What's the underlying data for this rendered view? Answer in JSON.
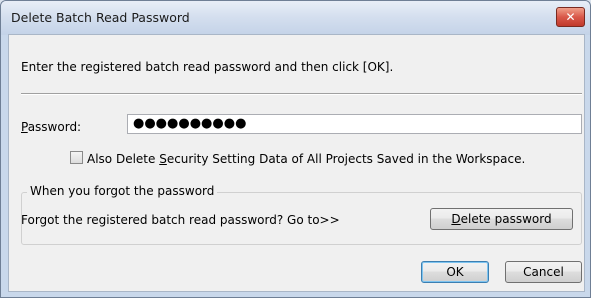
{
  "window": {
    "title": "Delete Batch Read Password",
    "close_glyph": "✕"
  },
  "instruction": "Enter the registered batch read password and then click [OK].",
  "password": {
    "label_u": "P",
    "label_rest": "assword:",
    "value": "●●●●●●●●●●"
  },
  "also_delete": {
    "checked": false,
    "label_pre": "Also Delete ",
    "label_u": "S",
    "label_post": "ecurity Setting Data of All Projects Saved in the Workspace."
  },
  "forgot_group": {
    "legend": "When you forgot the password",
    "text": "Forgot the registered batch read password? Go to>>",
    "button_u": "D",
    "button_rest": "elete password"
  },
  "buttons": {
    "ok": "OK",
    "cancel": "Cancel"
  }
}
